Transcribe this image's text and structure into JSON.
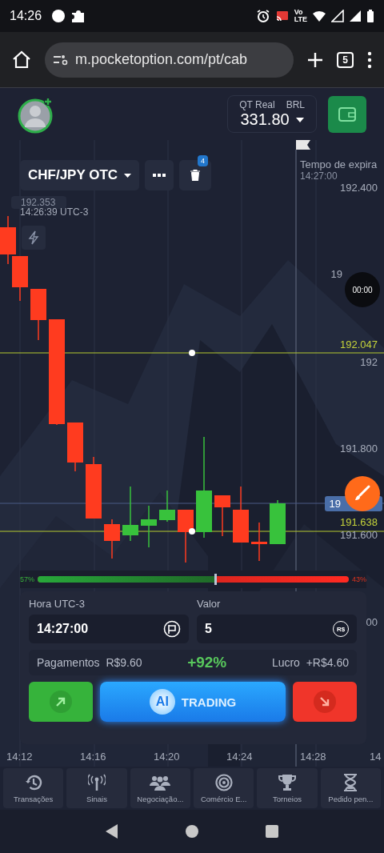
{
  "status_bar": {
    "time": "14:26",
    "volte": [
      "Vo",
      "LTE"
    ]
  },
  "browser": {
    "url": "m.pocketoption.com/pt/cab",
    "tab_count": "5"
  },
  "header": {
    "account_type": "QT Real",
    "currency": "BRL",
    "balance": "331.80"
  },
  "asset": {
    "name": "CHF/JPY OTC",
    "badge": "4"
  },
  "chart": {
    "current_price": "192.353",
    "current_time": "14:26:39 UTC-3",
    "expiry_label": "Tempo de expira",
    "expiry_time": "14:27:00",
    "timer": "00:00",
    "price_labels": [
      {
        "text": "192.400",
        "kind": "tick"
      },
      {
        "text": "19",
        "kind": "tick"
      },
      {
        "text": "192.047",
        "kind": "line"
      },
      {
        "text": "192",
        "kind": "tick"
      },
      {
        "text": "191.800",
        "kind": "tick"
      },
      {
        "text": "19",
        "kind": "current"
      },
      {
        "text": "191.638",
        "kind": "line"
      },
      {
        "text": "191.600",
        "kind": "tick"
      },
      {
        "text": "00",
        "kind": "tick"
      }
    ],
    "time_labels": [
      "14:12",
      "14:16",
      "14:20",
      "14:24",
      "14:28",
      "14"
    ],
    "sentiment": {
      "up": "57%",
      "down": "43%",
      "level": 0.57
    }
  },
  "trade": {
    "time_label": "Hora UTC-3",
    "time_value": "14:27:00",
    "amount_label": "Valor",
    "amount_value": "5",
    "currency_symbol": "R$",
    "payout_label": "Pagamentos",
    "payout_value": "R$9.60",
    "percent": "+92%",
    "profit_label": "Lucro",
    "profit_value": "+R$4.60",
    "ai_badge": "AI",
    "ai_label": "TRADING"
  },
  "nav": [
    {
      "label": "Transações",
      "selected": false
    },
    {
      "label": "Sinais",
      "selected": false
    },
    {
      "label": "Negociação...",
      "selected": false
    },
    {
      "label": "Comércio E...",
      "selected": false
    },
    {
      "label": "Torneios",
      "selected": false
    },
    {
      "label": "Pedido pen...",
      "selected": false
    }
  ]
}
